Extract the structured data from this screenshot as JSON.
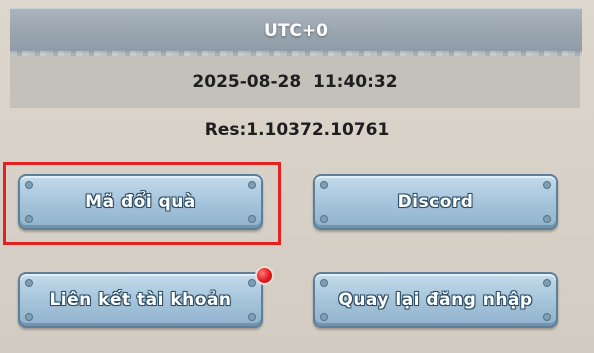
{
  "header": {
    "timezone": "UTC+0"
  },
  "datetime": {
    "value": "2025-08-28  11:40:32"
  },
  "resolution": {
    "text": "Res:1.10372.10761"
  },
  "buttons": {
    "gift_code": "Mã đổi quà",
    "discord": "Discord",
    "link_account": "Liên kết tài khoản",
    "back_to_login": "Quay lại đăng nhập"
  },
  "colors": {
    "highlight": "#e52020",
    "notification": "#e11a1a",
    "button_fill": "#a9c7dd"
  }
}
